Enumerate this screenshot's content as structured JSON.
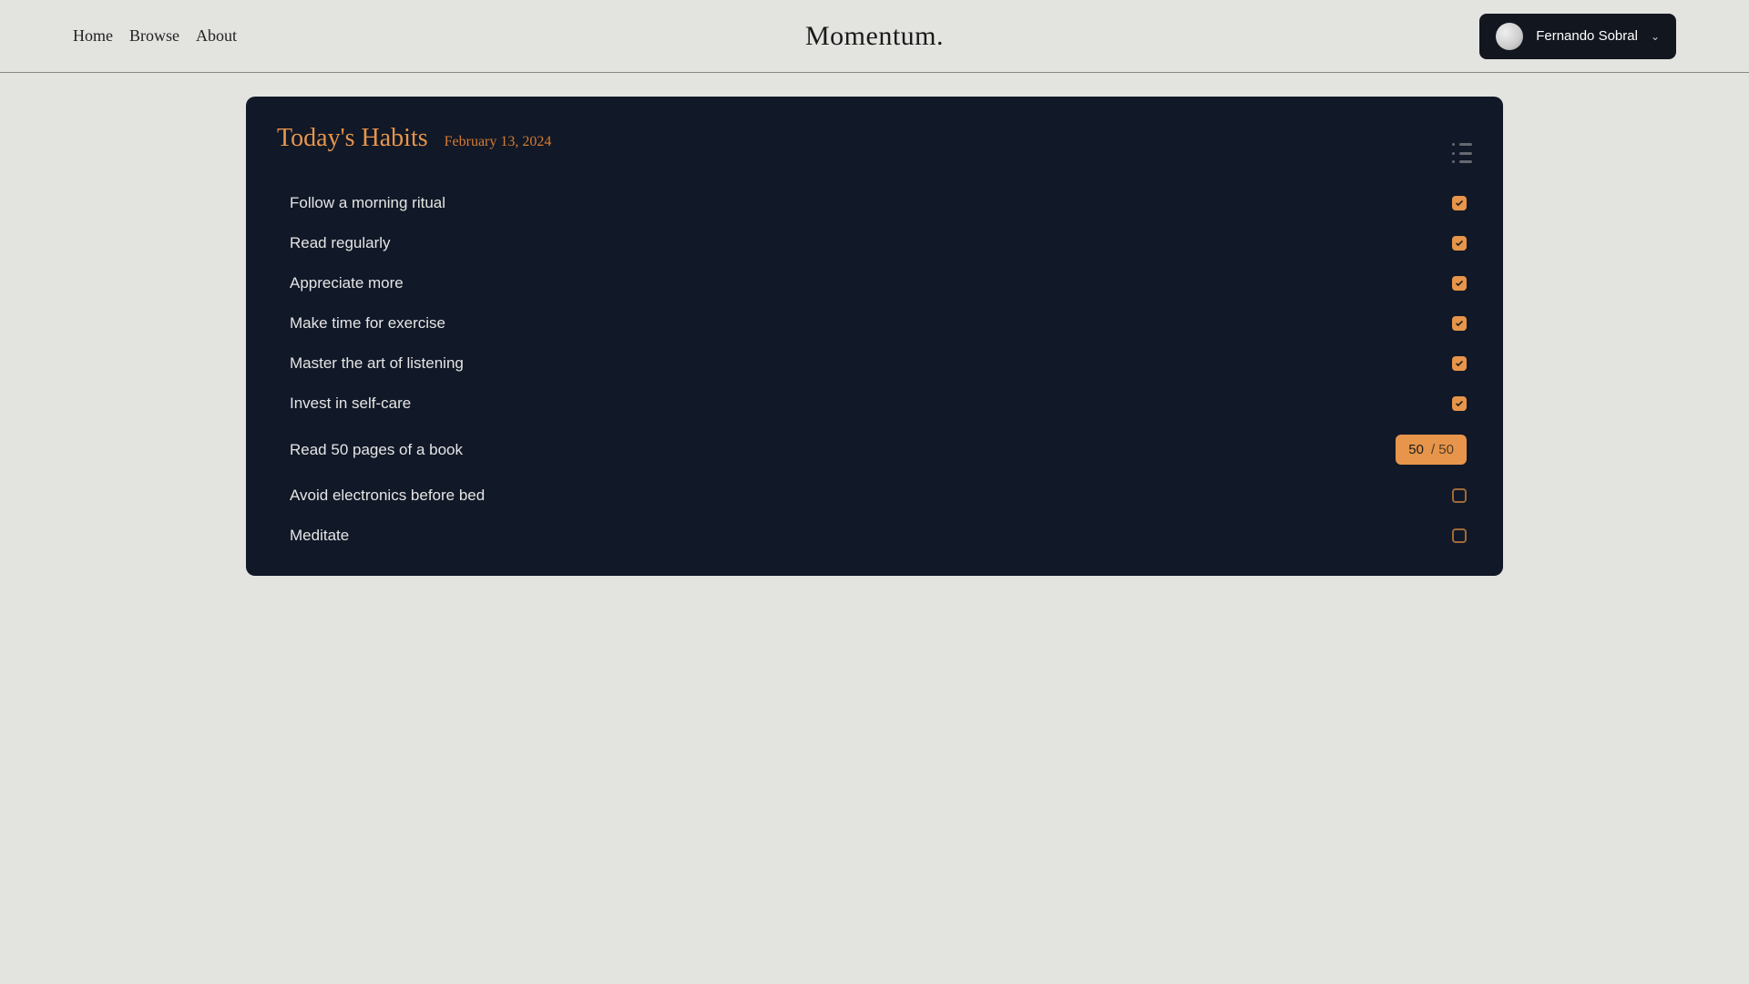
{
  "nav": {
    "links": [
      "Home",
      "Browse",
      "About"
    ]
  },
  "brand": "Momentum.",
  "user": {
    "name": "Fernando Sobral"
  },
  "card": {
    "title": "Today's Habits",
    "date": "February 13, 2024"
  },
  "habits": [
    {
      "label": "Follow a morning ritual",
      "type": "check",
      "done": true
    },
    {
      "label": "Read regularly",
      "type": "check",
      "done": true
    },
    {
      "label": "Appreciate more",
      "type": "check",
      "done": true
    },
    {
      "label": "Make time for exercise",
      "type": "check",
      "done": true
    },
    {
      "label": "Master the art of listening",
      "type": "check",
      "done": true
    },
    {
      "label": "Invest in self-care",
      "type": "check",
      "done": true
    },
    {
      "label": "Read 50 pages of a book",
      "type": "progress",
      "value": 50,
      "total": 50
    },
    {
      "label": "Avoid electronics before bed",
      "type": "check",
      "done": false
    },
    {
      "label": "Meditate",
      "type": "check",
      "done": false
    }
  ]
}
